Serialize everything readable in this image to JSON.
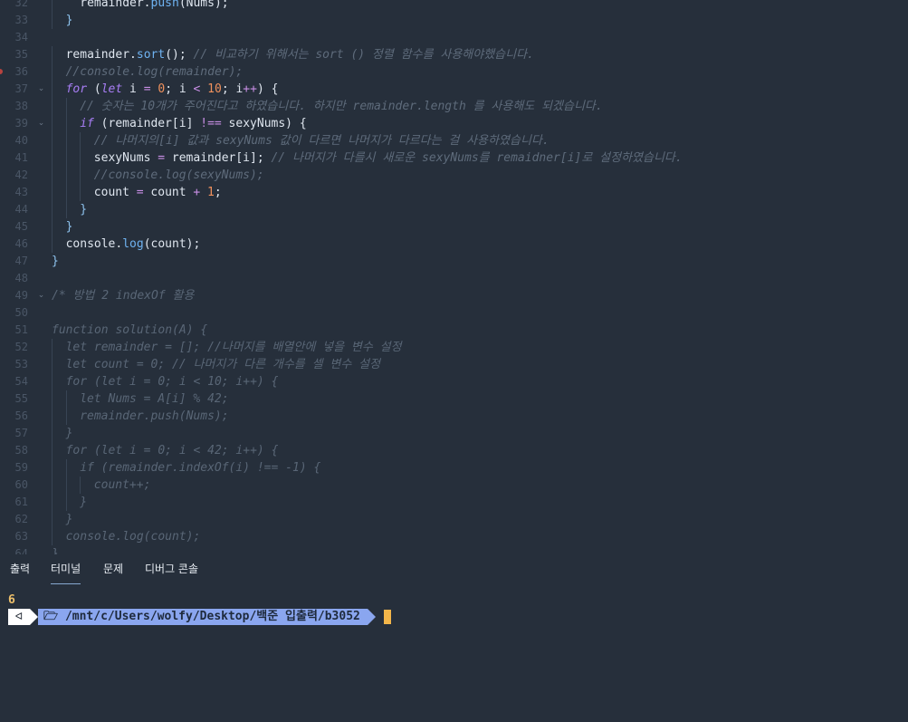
{
  "editor": {
    "lines": [
      {
        "n": "32",
        "indent": 1,
        "tokens": [
          [
            "plain",
            "  remainder."
          ],
          [
            "fn",
            "push"
          ],
          [
            "plain",
            "(Nums);"
          ]
        ]
      },
      {
        "n": "33",
        "indent": 1,
        "tokens": [
          [
            "pun",
            "}"
          ]
        ]
      },
      {
        "n": "34",
        "tokens": []
      },
      {
        "n": "35",
        "indent": 1,
        "tokens": [
          [
            "plain",
            "remainder."
          ],
          [
            "fn",
            "sort"
          ],
          [
            "plain",
            "(); "
          ],
          [
            "cm",
            "// 비교하기 위해서는 sort () 정렬 함수를 사용해야했습니다."
          ]
        ]
      },
      {
        "n": "36",
        "indent": 1,
        "breakpoint": true,
        "tokens": [
          [
            "cm",
            "//console.log(remainder);"
          ]
        ]
      },
      {
        "n": "37",
        "indent": 1,
        "fold": true,
        "tokens": [
          [
            "kw",
            "for"
          ],
          [
            "plain",
            " ("
          ],
          [
            "kw",
            "let"
          ],
          [
            "plain",
            " i "
          ],
          [
            "op",
            "="
          ],
          [
            "plain",
            " "
          ],
          [
            "num",
            "0"
          ],
          [
            "plain",
            "; i "
          ],
          [
            "op",
            "<"
          ],
          [
            "plain",
            " "
          ],
          [
            "num",
            "10"
          ],
          [
            "plain",
            "; i"
          ],
          [
            "op",
            "++"
          ],
          [
            "plain",
            ") {"
          ]
        ]
      },
      {
        "n": "38",
        "indent": 2,
        "tokens": [
          [
            "cm",
            "// 숫자는 10개가 주어진다고 하였습니다. 하지만 remainder.length 를 사용해도 되겠습니다."
          ]
        ]
      },
      {
        "n": "39",
        "indent": 2,
        "fold": true,
        "tokens": [
          [
            "kw",
            "if"
          ],
          [
            "plain",
            " (remainder[i] "
          ],
          [
            "op",
            "!=="
          ],
          [
            "plain",
            " sexyNums) {"
          ]
        ]
      },
      {
        "n": "40",
        "indent": 3,
        "tokens": [
          [
            "cm",
            "// 나머지의[i] 값과 sexyNums 값이 다르면 나머지가 다르다는 걸 사용하였습니다."
          ]
        ]
      },
      {
        "n": "41",
        "indent": 3,
        "tokens": [
          [
            "plain",
            "sexyNums "
          ],
          [
            "op",
            "="
          ],
          [
            "plain",
            " remainder[i]; "
          ],
          [
            "cm",
            "// 나머지가 다를시 새로운 sexyNums를 remaidner[i]로 설정하였습니다."
          ]
        ]
      },
      {
        "n": "42",
        "indent": 3,
        "tokens": [
          [
            "cm",
            "//console.log(sexyNums);"
          ]
        ]
      },
      {
        "n": "43",
        "indent": 3,
        "tokens": [
          [
            "plain",
            "count "
          ],
          [
            "op",
            "="
          ],
          [
            "plain",
            " count "
          ],
          [
            "op",
            "+"
          ],
          [
            "plain",
            " "
          ],
          [
            "num",
            "1"
          ],
          [
            "plain",
            ";"
          ]
        ]
      },
      {
        "n": "44",
        "indent": 2,
        "tokens": [
          [
            "pun",
            "}"
          ]
        ]
      },
      {
        "n": "45",
        "indent": 1,
        "tokens": [
          [
            "pun",
            "}"
          ]
        ]
      },
      {
        "n": "46",
        "indent": 1,
        "tokens": [
          [
            "plain",
            "console."
          ],
          [
            "fn",
            "log"
          ],
          [
            "plain",
            "(count);"
          ]
        ]
      },
      {
        "n": "47",
        "indent": 0,
        "tokens": [
          [
            "pun",
            "}"
          ]
        ]
      },
      {
        "n": "48",
        "tokens": []
      },
      {
        "n": "49",
        "indent": 0,
        "fold": true,
        "tokens": [
          [
            "dim",
            "/* 방법 2 indexOf 활용"
          ]
        ]
      },
      {
        "n": "50",
        "tokens": []
      },
      {
        "n": "51",
        "indent": 0,
        "tokens": [
          [
            "dim",
            "function solution(A) {"
          ]
        ]
      },
      {
        "n": "52",
        "indent": 1,
        "tokens": [
          [
            "dim",
            "let remainder = []; //나머지를 배열안에 넣을 변수 설정"
          ]
        ]
      },
      {
        "n": "53",
        "indent": 1,
        "tokens": [
          [
            "dim",
            "let count = 0; // 나머지가 다른 개수를 셀 변수 설정"
          ]
        ]
      },
      {
        "n": "54",
        "indent": 1,
        "tokens": [
          [
            "dim",
            "for (let i = 0; i < 10; i++) {"
          ]
        ]
      },
      {
        "n": "55",
        "indent": 2,
        "tokens": [
          [
            "dim",
            "let Nums = A[i] % 42;"
          ]
        ]
      },
      {
        "n": "56",
        "indent": 2,
        "tokens": [
          [
            "dim",
            "remainder.push(Nums);"
          ]
        ]
      },
      {
        "n": "57",
        "indent": 1,
        "tokens": [
          [
            "dim",
            "}"
          ]
        ]
      },
      {
        "n": "58",
        "indent": 1,
        "tokens": [
          [
            "dim",
            "for (let i = 0; i < 42; i++) {"
          ]
        ]
      },
      {
        "n": "59",
        "indent": 2,
        "tokens": [
          [
            "dim",
            "if (remainder.indexOf(i) !== -1) {"
          ]
        ]
      },
      {
        "n": "60",
        "indent": 3,
        "tokens": [
          [
            "dim",
            "count++;"
          ]
        ]
      },
      {
        "n": "61",
        "indent": 2,
        "tokens": [
          [
            "dim",
            "}"
          ]
        ]
      },
      {
        "n": "62",
        "indent": 1,
        "tokens": [
          [
            "dim",
            "}"
          ]
        ]
      },
      {
        "n": "63",
        "indent": 1,
        "tokens": [
          [
            "dim",
            "console.log(count);"
          ]
        ]
      },
      {
        "n": "64",
        "indent": 0,
        "tokens": [
          [
            "dim",
            "}"
          ]
        ]
      }
    ]
  },
  "panel": {
    "tabs": [
      {
        "label": "출력",
        "active": false
      },
      {
        "label": "터미널",
        "active": true
      },
      {
        "label": "문제",
        "active": false
      },
      {
        "label": "디버그 콘솔",
        "active": false
      }
    ]
  },
  "terminal": {
    "output": "6",
    "prompt_os_glyph": "ᐊ",
    "prompt_folder_icon": "folder-icon",
    "prompt_path_prefix": "/mnt/c/Users/wolfy/Desktop/백준 입출력/",
    "prompt_path_dir": "b3052"
  },
  "colors": {
    "background": "#262f3b",
    "accent": "#8aa6ef",
    "cursor": "#f3b64a"
  }
}
